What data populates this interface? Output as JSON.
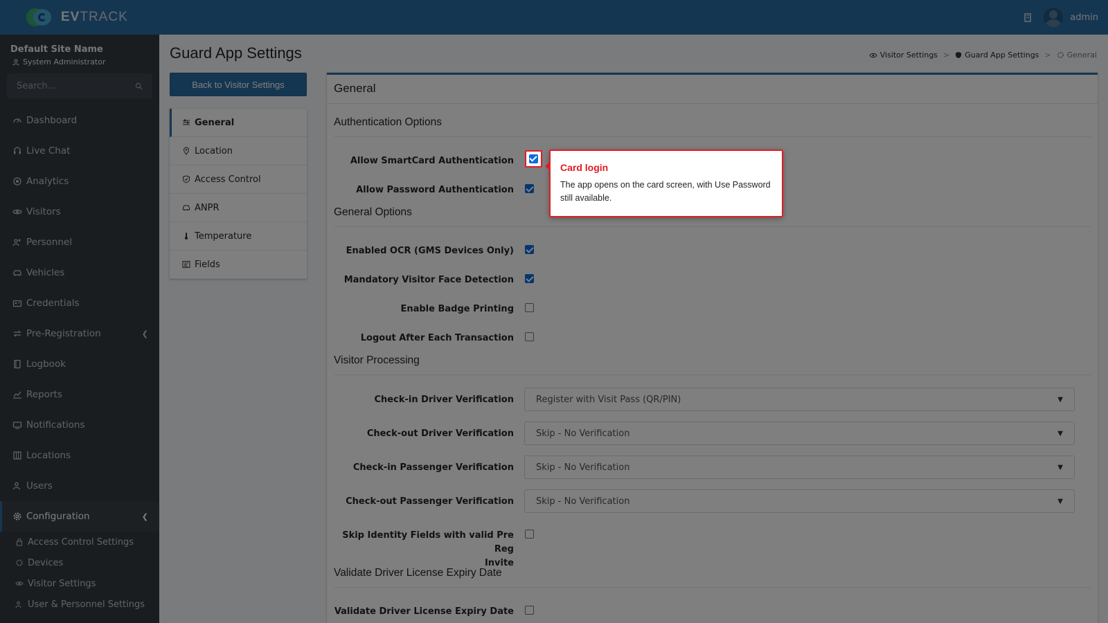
{
  "app": {
    "logo_bold": "EV",
    "logo_rest": "TRACK",
    "user": "admin"
  },
  "sidebar": {
    "site_name": "Default Site Name",
    "role": "System Administrator",
    "search_placeholder": "Search...",
    "items": [
      {
        "label": "Dashboard",
        "icon": "dashboard-icon"
      },
      {
        "label": "Live Chat",
        "icon": "headset-icon"
      },
      {
        "label": "Analytics",
        "icon": "analytics-icon"
      },
      {
        "label": "Visitors",
        "icon": "eye-icon"
      },
      {
        "label": "Personnel",
        "icon": "users-icon"
      },
      {
        "label": "Vehicles",
        "icon": "car-icon"
      },
      {
        "label": "Credentials",
        "icon": "id-card-icon"
      },
      {
        "label": "Pre-Registration",
        "icon": "exchange-icon"
      },
      {
        "label": "Logbook",
        "icon": "book-icon"
      },
      {
        "label": "Reports",
        "icon": "chart-icon"
      },
      {
        "label": "Notifications",
        "icon": "bell-icon"
      },
      {
        "label": "Locations",
        "icon": "building-icon"
      },
      {
        "label": "Users",
        "icon": "user-icon"
      },
      {
        "label": "Configuration",
        "icon": "gear-icon"
      }
    ],
    "subitems": [
      {
        "label": "Access Control Settings"
      },
      {
        "label": "Devices"
      },
      {
        "label": "Visitor Settings"
      },
      {
        "label": "User & Personnel Settings"
      }
    ]
  },
  "page": {
    "title": "Guard App Settings",
    "back_button": "Back to Visitor Settings",
    "breadcrumb": [
      "Visitor Settings",
      "Guard App Settings",
      "General"
    ],
    "breadcrumb_sep": ">"
  },
  "settings_nav": [
    {
      "label": "General"
    },
    {
      "label": "Location"
    },
    {
      "label": "Access Control"
    },
    {
      "label": "ANPR"
    },
    {
      "label": "Temperature"
    },
    {
      "label": "Fields"
    }
  ],
  "card": {
    "title": "General",
    "sections": {
      "auth": "Authentication Options",
      "general": "General Options",
      "visitor": "Visitor Processing",
      "license": "Validate Driver License Expiry Date"
    },
    "checkboxes": {
      "smartcard": {
        "label": "Allow SmartCard Authentication",
        "checked": true
      },
      "password": {
        "label": "Allow Password Authentication",
        "checked": true
      },
      "ocr": {
        "label": "Enabled OCR (GMS Devices Only)",
        "checked": true
      },
      "face": {
        "label": "Mandatory Visitor Face Detection",
        "checked": true
      },
      "badge": {
        "label": "Enable Badge Printing",
        "checked": false
      },
      "logout": {
        "label": "Logout After Each Transaction",
        "checked": false
      },
      "skip_identity_1": {
        "label": "Skip Identity Fields with valid Pre Reg",
        "checked": false
      },
      "skip_identity_2": {
        "label": "Invite"
      },
      "license_expiry": {
        "label": "Validate Driver License Expiry Date",
        "checked": false
      }
    },
    "selects": {
      "checkin_driver": {
        "label": "Check-in Driver Verification",
        "value": "Register with Visit Pass (QR/PIN)"
      },
      "checkout_driver": {
        "label": "Check-out Driver Verification",
        "value": "Skip - No Verification"
      },
      "checkin_passenger": {
        "label": "Check-in Passenger Verification",
        "value": "Skip - No Verification"
      },
      "checkout_passenger": {
        "label": "Check-out Passenger Verification",
        "value": "Skip - No Verification"
      }
    }
  },
  "callout": {
    "title": "Card login",
    "body": "The app opens on the card screen, with Use Password still available."
  },
  "colors": {
    "brand": "#2b6ca3",
    "sidebar": "#343a40",
    "accent_red": "#e31b23",
    "checkbox": "#0b6dde"
  }
}
